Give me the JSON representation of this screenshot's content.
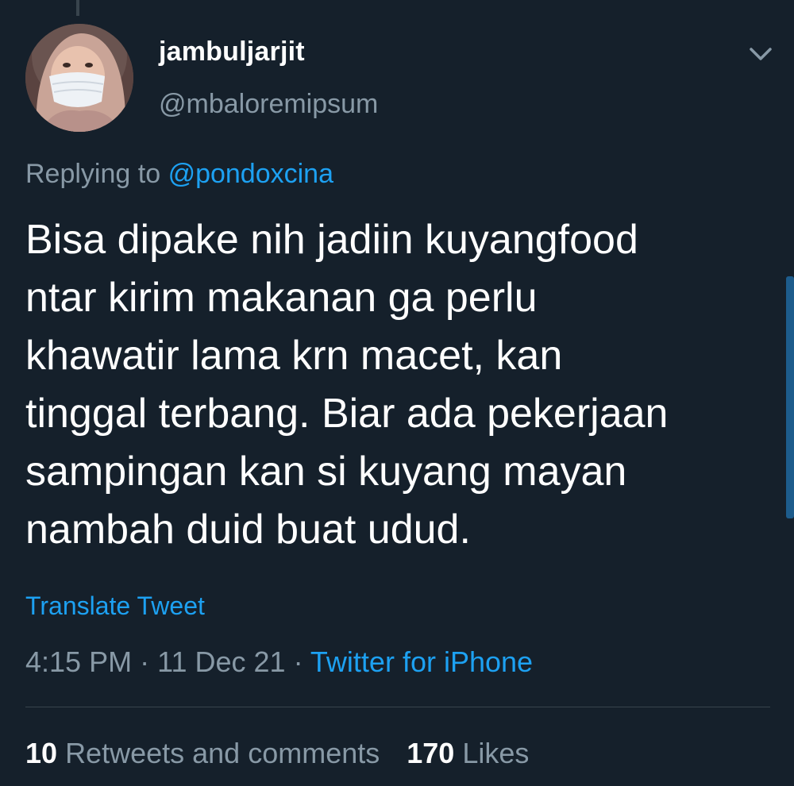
{
  "author": {
    "display_name": "jambuljarjit",
    "handle": "@mbaloremipsum",
    "avatar_icon": "profile-photo"
  },
  "reply": {
    "prefix": "Replying to",
    "mention": "@pondoxcina"
  },
  "tweet": {
    "lines": [
      "Bisa dipake nih jadiin kuyangfood",
      "ntar kirim makanan ga perlu",
      "khawatir lama krn macet, kan",
      "tinggal terbang. Biar ada pekerjaan",
      "sampingan kan si kuyang mayan",
      "nambah duid buat udud."
    ]
  },
  "translate_label": "Translate Tweet",
  "meta": {
    "time": "4:15 PM",
    "separator": "·",
    "date": "11 Dec 21",
    "source": "Twitter for iPhone"
  },
  "stats": {
    "retweets_count": "10",
    "retweets_label": "Retweets and comments",
    "likes_count": "170",
    "likes_label": "Likes"
  },
  "colors": {
    "background": "#15202b",
    "text_primary": "#ffffff",
    "text_secondary": "#8899a6",
    "accent": "#1da1f2",
    "divider": "#38444d"
  }
}
